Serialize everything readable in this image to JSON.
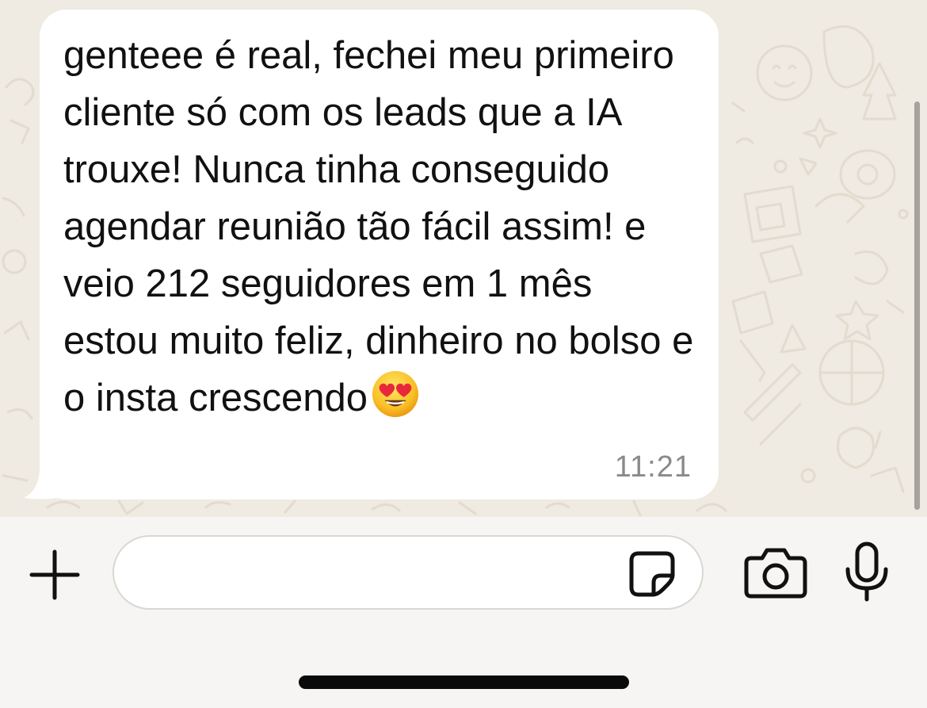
{
  "conversation": {
    "messages": [
      {
        "direction": "incoming",
        "text": "genteee é real, fechei meu primeiro cliente só com os leads que a IA trouxe! Nunca tinha conseguido agendar reunião tão fácil assim! e veio 212 seguidores em 1 mês estou muito feliz, dinheiro no bolso e o insta crescendo",
        "emoji": "smiling-face-with-heart-eyes",
        "time": "11:21"
      }
    ]
  },
  "composer": {
    "placeholder": "",
    "value": "",
    "icons": {
      "attach": "plus-icon",
      "sticker": "sticker-icon",
      "camera": "camera-icon",
      "microphone": "microphone-icon"
    }
  },
  "colors": {
    "wallpaper": "#efeae2",
    "bubble": "#ffffff",
    "text": "#111111",
    "timestamp": "#8a8a8a"
  }
}
